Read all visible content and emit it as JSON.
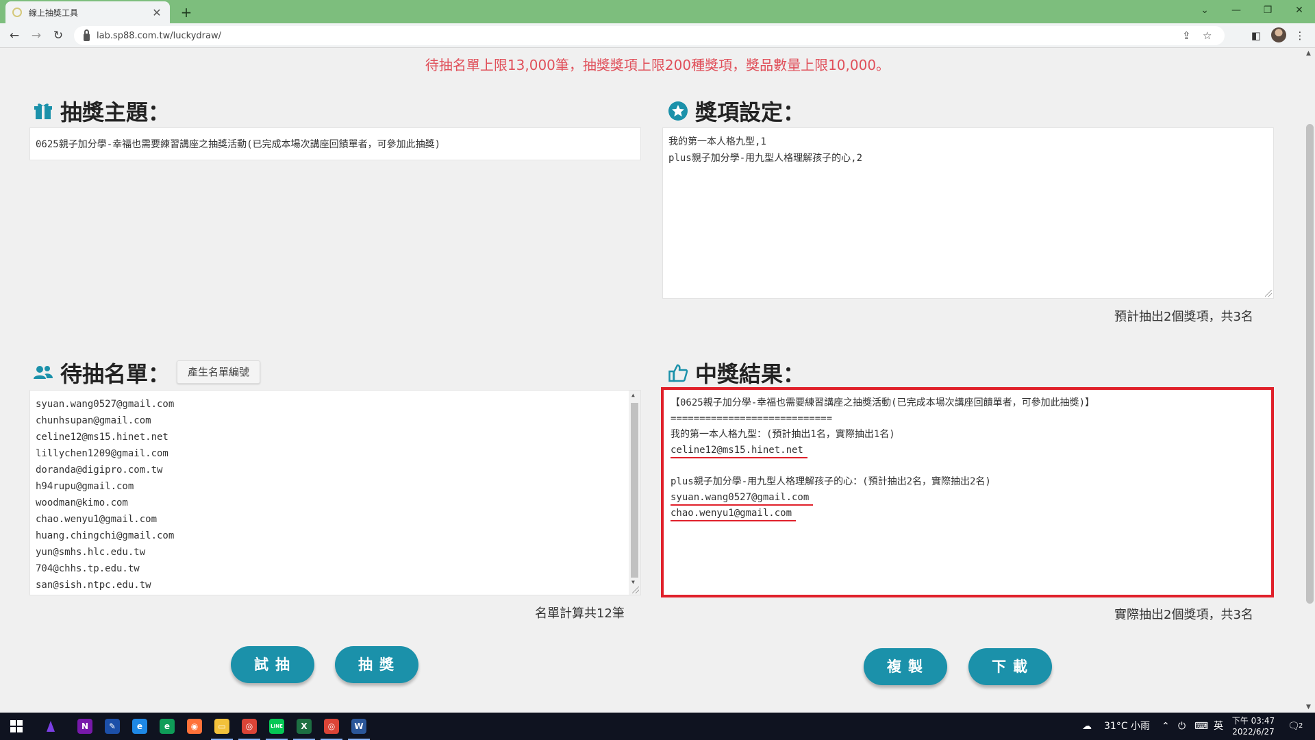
{
  "browser": {
    "tab_title": "線上抽獎工具",
    "tab_close": "✕",
    "new_tab": "+",
    "url": "lab.sp88.com.tw/luckydraw/",
    "win_minimize": "—",
    "win_restore": "❐",
    "win_close": "✕",
    "win_menu": "⌄"
  },
  "page": {
    "notice": "待抽名單上限13,000筆，抽獎獎項上限200種獎項，獎品數量上限10,000。",
    "topic": {
      "title": "抽獎主題：",
      "icon": "gift-icon",
      "value": "0625親子加分學-幸福也需要練習講座之抽獎活動(已完成本場次講座回饋單者，可參加此抽獎)"
    },
    "prizes": {
      "title": "獎項設定：",
      "icon": "star-icon",
      "lines": [
        "我的第一本人格九型,1",
        "plus親子加分學-用九型人格理解孩子的心,2"
      ],
      "summary": "預計抽出2個獎項，共3名"
    },
    "participants": {
      "title": "待抽名單：",
      "icon": "people-icon",
      "generate_button": "產生名單編號",
      "entries": [
        "syuan.wang0527@gmail.com",
        "chunhsupan@gmail.com",
        "celine12@ms15.hinet.net",
        "lillychen1209@gmail.com",
        "doranda@digipro.com.tw",
        "h94rupu@gmail.com",
        "woodman@kimo.com",
        "chao.wenyu1@gmail.com",
        "huang.chingchi@gmail.com",
        "yun@smhs.hlc.edu.tw",
        "704@chhs.tp.edu.tw",
        "san@sish.ntpc.edu.tw"
      ],
      "count_text": "名單計算共12筆"
    },
    "results": {
      "title": "中獎結果：",
      "icon": "thumbs-up-icon",
      "header": "【0625親子加分學-幸福也需要練習講座之抽獎活動(已完成本場次講座回饋單者，可參加此抽獎)】",
      "divider": "============================",
      "prize1_label": "我的第一本人格九型：(預計抽出1名，實際抽出1名)",
      "prize1_winners": [
        "celine12@ms15.hinet.net"
      ],
      "prize2_label": "plus親子加分學-用九型人格理解孩子的心：(預計抽出2名，實際抽出2名)",
      "prize2_winners": [
        "syuan.wang0527@gmail.com",
        "chao.wenyu1@gmail.com"
      ],
      "summary": "實際抽出2個獎項，共3名"
    },
    "buttons": {
      "trial": "試抽",
      "draw": "抽獎",
      "copy": "複製",
      "download": "下載"
    }
  },
  "taskbar": {
    "weather": "31°C 小雨",
    "ime": "英",
    "time": "下午 03:47",
    "date": "2022/6/27",
    "notifications": "2",
    "apps": [
      {
        "name": "onenote",
        "label": "N",
        "color": "#7719aa"
      },
      {
        "name": "whiteboard",
        "label": "✎",
        "color": "#1c4fa8"
      },
      {
        "name": "internet-explorer",
        "label": "e",
        "color": "#1e88e5"
      },
      {
        "name": "edge",
        "label": "e",
        "color": "#0f9d58"
      },
      {
        "name": "firefox",
        "label": "◉",
        "color": "#ff7139"
      },
      {
        "name": "file-explorer",
        "label": "▭",
        "color": "#f3c13a"
      },
      {
        "name": "chrome",
        "label": "◎",
        "color": "#db4437"
      },
      {
        "name": "line",
        "label": "LINE",
        "color": "#06c755"
      },
      {
        "name": "excel",
        "label": "X",
        "color": "#1d6f42"
      },
      {
        "name": "chrome-2",
        "label": "◎",
        "color": "#db4437"
      },
      {
        "name": "word",
        "label": "W",
        "color": "#2b579a"
      }
    ]
  }
}
